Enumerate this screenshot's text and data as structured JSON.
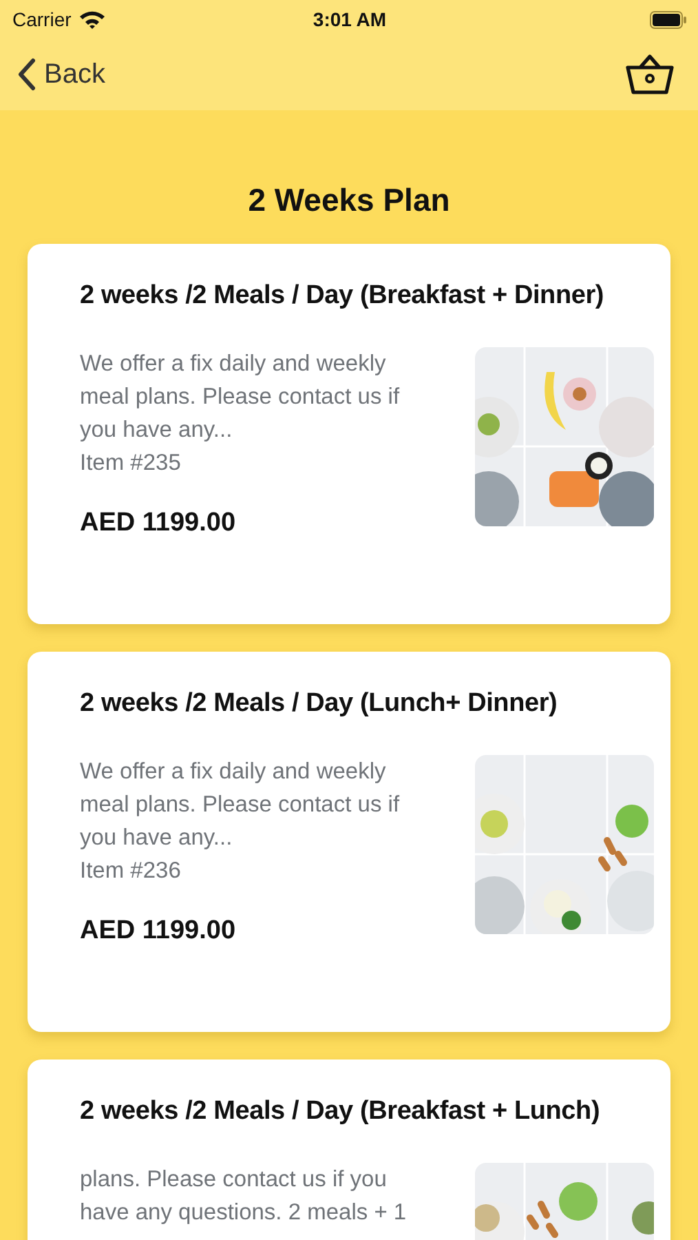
{
  "status_bar": {
    "carrier": "Carrier",
    "time": "3:01 AM"
  },
  "nav": {
    "back": "Back"
  },
  "title": "2 Weeks Plan",
  "plans": [
    {
      "name": "2 weeks /2 Meals / Day (Breakfast + Dinner)",
      "description": "We offer a fix daily and weekly meal plans. Please contact us if you have any...",
      "item": "Item #235",
      "price": "AED 1199.00"
    },
    {
      "name": "2 weeks /2 Meals / Day (Lunch+ Dinner)",
      "description": "We offer a fix daily and weekly meal plans. Please contact us if you have any...",
      "item": "Item #236",
      "price": "AED 1199.00"
    },
    {
      "name": "2 weeks /2 Meals / Day (Breakfast + Lunch)",
      "description": "plans. Please contact us if you have any questions. 2 meals + 1"
    }
  ]
}
